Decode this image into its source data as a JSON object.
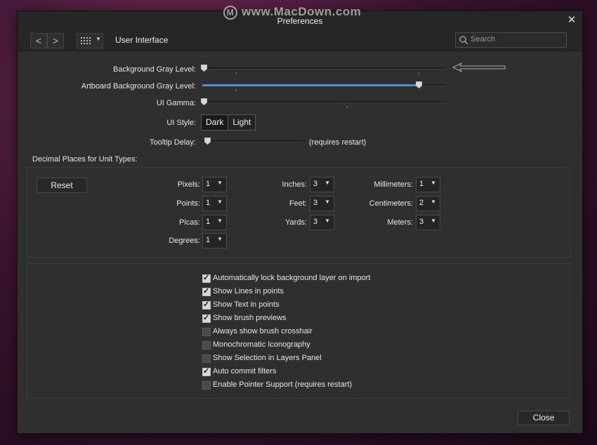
{
  "watermark": "www.MacDown.com",
  "window": {
    "title": "Preferences"
  },
  "toolbar": {
    "back": "<",
    "forward": ">",
    "breadcrumb": "User Interface",
    "search_placeholder": "Search"
  },
  "sliders": [
    {
      "label": "Background Gray Level:",
      "value": 0.0
    },
    {
      "label": "Artboard Background Gray Level:",
      "value": 0.89
    },
    {
      "label": "UI Gamma:",
      "value": 0.0
    }
  ],
  "ui_style": {
    "label": "UI Style:",
    "options": [
      "Dark",
      "Light"
    ],
    "selected": "Dark"
  },
  "tooltip_delay": {
    "label": "Tooltip Delay:",
    "value": 0.05,
    "note": "(requires restart)"
  },
  "decimal": {
    "title": "Decimal Places for Unit Types:",
    "reset": "Reset",
    "units": [
      {
        "label": "Pixels:",
        "value": "1"
      },
      {
        "label": "Points:",
        "value": "1"
      },
      {
        "label": "Picas:",
        "value": "1"
      },
      {
        "label": "Degrees:",
        "value": "1"
      },
      {
        "label": "Inches:",
        "value": "3"
      },
      {
        "label": "Feet:",
        "value": "3"
      },
      {
        "label": "Yards:",
        "value": "3"
      },
      {
        "label": "Millimeters:",
        "value": "1"
      },
      {
        "label": "Centimeters:",
        "value": "2"
      },
      {
        "label": "Meters:",
        "value": "3"
      }
    ]
  },
  "options": [
    {
      "label": "Automatically lock background layer on import",
      "checked": true
    },
    {
      "label": "Show Lines in points",
      "checked": true
    },
    {
      "label": "Show Text in points",
      "checked": true
    },
    {
      "label": "Show brush previews",
      "checked": true
    },
    {
      "label": "Always show brush crosshair",
      "checked": false
    },
    {
      "label": "Monochromatic Iconography",
      "checked": false
    },
    {
      "label": "Show Selection in Layers Panel",
      "checked": false
    },
    {
      "label": "Auto commit filters",
      "checked": true
    },
    {
      "label": "Enable Pointer Support (requires restart)",
      "checked": false
    }
  ],
  "footer": {
    "close": "Close"
  },
  "colors": {
    "accent": "#5a8bd6",
    "panel": "#2f2f2f",
    "toolbar": "#262626"
  }
}
